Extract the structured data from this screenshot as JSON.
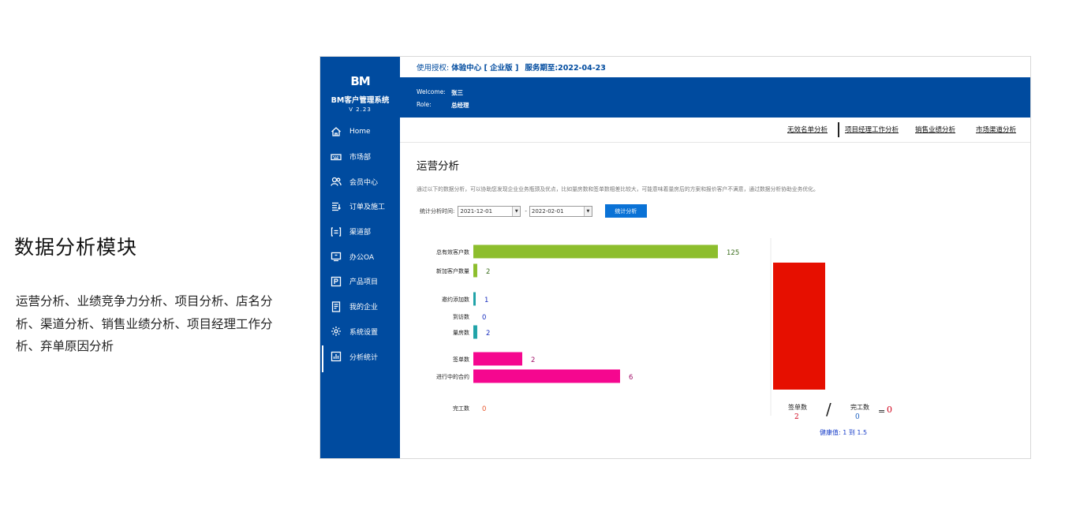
{
  "intro": {
    "title": "数据分析模块",
    "description": "运营分析、业绩竞争力分析、项目分析、店名分析、渠道分析、销售业绩分析、项目经理工作分析、弃单原因分析"
  },
  "sidebar": {
    "logo": "BM",
    "system_name": "BM客户管理系统",
    "version": "V 2.23",
    "items": [
      {
        "label": "Home",
        "icon": "home-icon"
      },
      {
        "label": "市场部",
        "icon": "keyboard-icon"
      },
      {
        "label": "会员中心",
        "icon": "users-icon"
      },
      {
        "label": "订单及施工",
        "icon": "order-list-icon"
      },
      {
        "label": "渠道部",
        "icon": "bracket-list-icon"
      },
      {
        "label": "办公OA",
        "icon": "monitor-icon"
      },
      {
        "label": "产品项目",
        "icon": "product-icon"
      },
      {
        "label": "我的企业",
        "icon": "document-icon"
      },
      {
        "label": "系统设置",
        "icon": "gear-icon"
      },
      {
        "label": "分析统计",
        "icon": "bar-chart-icon"
      }
    ],
    "active_index": 9
  },
  "header": {
    "license_label": "使用授权:",
    "license_value": "体验中心 [ 企业版 ]",
    "expire": "服务期至:2022-04-23",
    "welcome_label": "Welcome:",
    "welcome_value": "张三",
    "role_label": "Role:",
    "role_value": "总经理"
  },
  "tabs": [
    "无效名单分析",
    "项目经理工作分析",
    "销售业绩分析",
    "市场渠道分析"
  ],
  "main": {
    "title": "运营分析",
    "description": "通过以下的数据分析，可以协助您发现企业业务瓶颈及优点，比如量房数和签单数相差比较大，可能意味着量房后的方案和报价客户不满意，通过数据分析协助业务优化。",
    "filter_label": "统计分析时间:",
    "date_start": "2021-12-01",
    "date_end": "2022-02-01",
    "date_sep": "-",
    "submit_label": "统计分析"
  },
  "chart_data": [
    {
      "type": "bar",
      "orientation": "horizontal",
      "categories": [
        "总有效客户数",
        "新加客户数量",
        "邀约添加数",
        "到访数",
        "量房数",
        "签单数",
        "进行中的合约",
        "完工数"
      ],
      "values": [
        125,
        2,
        1,
        0,
        2,
        2,
        6,
        0
      ],
      "colors": [
        "#8dbe2d",
        "#8dbe2d",
        "#21a3a8",
        "#21a3a8",
        "#21a3a8",
        "#f5078f",
        "#f5078f",
        "#e02410"
      ],
      "label_colors": [
        "#3b6e1d",
        "#3b6e1d",
        "#1a2fbf",
        "#1a2fbf",
        "#1a2fbf",
        "#a2116a",
        "#a2116a",
        "#e8582f"
      ]
    },
    {
      "type": "bar",
      "categories": [
        "签单数 / 完工数"
      ],
      "values": [
        1
      ],
      "colors": [
        "#e60f00"
      ]
    }
  ],
  "ratio": {
    "signed_label": "签单数",
    "signed_value": "2",
    "completed_label": "完工数",
    "completed_value": "0",
    "slash": "/",
    "equals": "=",
    "result": "0",
    "health_label": "健康值: 1 到 1.5"
  }
}
